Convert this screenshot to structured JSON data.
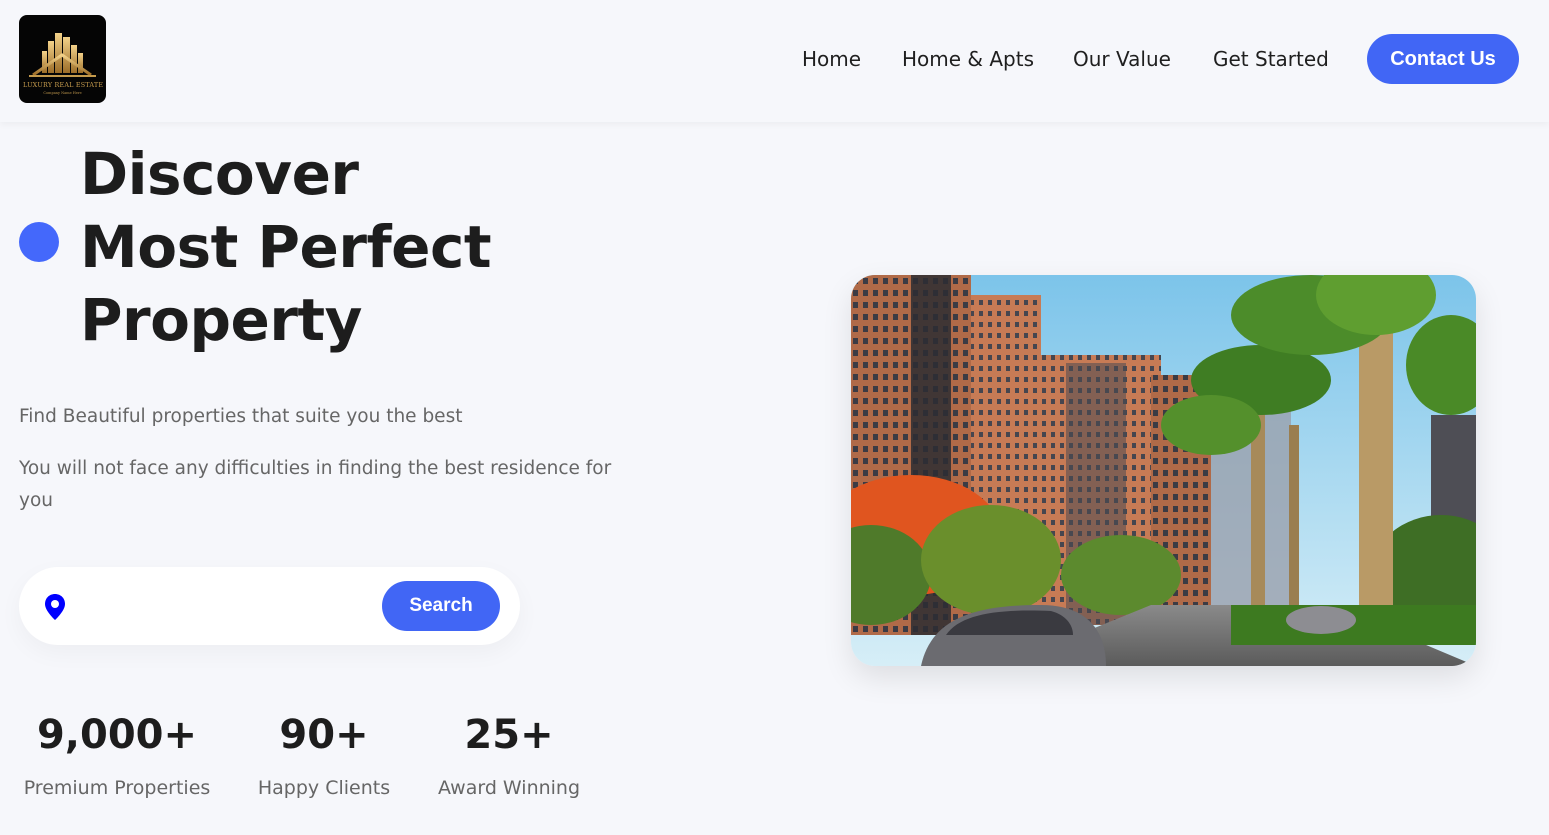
{
  "brand": {
    "logo_text": "LUXURY REAL ESTATE",
    "logo_subtext": "Company Name Here"
  },
  "nav": {
    "items": [
      "Home",
      "Home & Apts",
      "Our Value",
      "Get Started"
    ],
    "contact_label": "Contact Us"
  },
  "hero": {
    "title_lines": [
      "Discover",
      "Most Perfect",
      "Property"
    ],
    "subtitle_1": "Find Beautiful properties that suite you the best",
    "subtitle_2": "You will not face any difficulties in finding the best residence for you"
  },
  "search": {
    "placeholder": "",
    "value": "",
    "button_label": "Search"
  },
  "stats": [
    {
      "value": "9,000+",
      "label": "Premium Properties"
    },
    {
      "value": "90+",
      "label": "Happy Clients"
    },
    {
      "value": "25+",
      "label": "Award Winning"
    }
  ],
  "icons": {
    "location": "map-pin-icon"
  },
  "colors": {
    "accent": "#4166f5",
    "background": "#f6f7fb",
    "pin": "#0000ff"
  }
}
